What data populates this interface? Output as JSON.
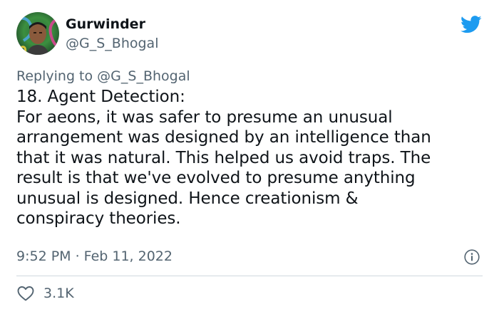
{
  "tweet": {
    "display_name": "Gurwinder",
    "handle": "@G_S_Bhogal",
    "replying_prefix": "Replying to ",
    "replying_handle": "@G_S_Bhogal",
    "text": "18. Agent Detection:\nFor aeons, it was safer to presume an unusual\narrangement was designed by an intelligence than\nthat it was natural. This helped us avoid traps. The\nresult is that we've evolved to presume anything\nunusual is designed. Hence creationism &\nconspiracy theories.",
    "timestamp": "9:52 PM · Feb 11, 2022",
    "like_count": "3.1K"
  },
  "icons": {
    "logo": "twitter-bird-icon",
    "info": "info-icon",
    "like": "heart-icon"
  },
  "colors": {
    "brand": "#1d9bf0",
    "text": "#0f1419",
    "secondary": "#536471",
    "divider": "#cfd9de"
  }
}
